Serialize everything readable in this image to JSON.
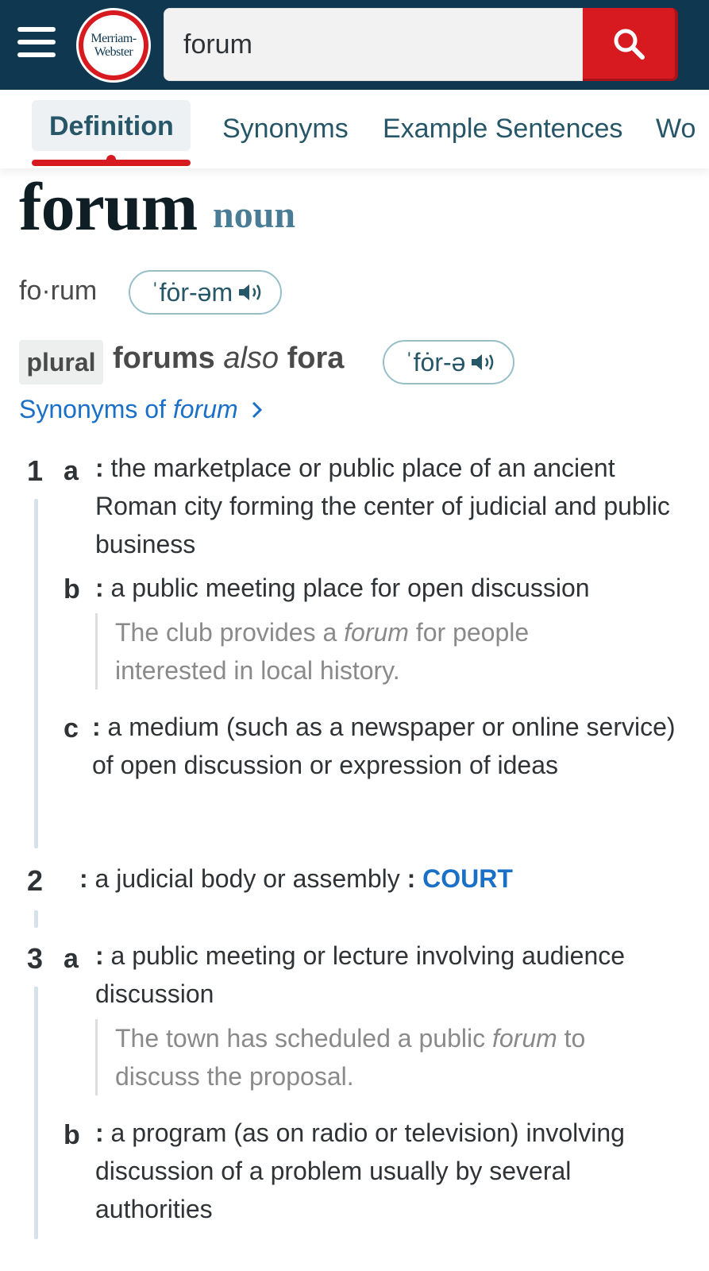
{
  "header": {
    "logo_line1": "Merriam-",
    "logo_line2": "Webster",
    "search_value": "forum"
  },
  "tabs": [
    {
      "label": "Definition",
      "active": true
    },
    {
      "label": "Synonyms"
    },
    {
      "label": "Example Sentences"
    },
    {
      "label": "Wo"
    }
  ],
  "entry": {
    "headword": "forum",
    "part_of_speech": "noun",
    "syllables": "fo·rum",
    "pronunciation": "ˈfȯr-əm",
    "plural_label": "plural",
    "plural_form1": "forums",
    "plural_also": "also",
    "plural_form2": "fora",
    "plural_pronunciation": "ˈfȯr-ə",
    "synonyms_link_prefix": "Synonyms of",
    "synonyms_link_word": "forum"
  },
  "senses": {
    "s1": {
      "num": "1",
      "a_letter": "a",
      "a_text": "the marketplace or public place of an ancient Roman city forming the center of judicial and public business",
      "b_letter": "b",
      "b_text": "a public meeting place for open discussion",
      "b_example_pre": "The club provides a",
      "b_example_word": "forum",
      "b_example_post": "for people interested in local history.",
      "c_letter": "c",
      "c_text": "a medium (such as a newspaper or online service) of open discussion or expression of ideas"
    },
    "s2": {
      "num": "2",
      "text": "a judicial body or assembly",
      "xref": "COURT"
    },
    "s3": {
      "num": "3",
      "a_letter": "a",
      "a_text": "a public meeting or lecture involving audience discussion",
      "a_example_pre": "The town has scheduled a public",
      "a_example_word": "forum",
      "a_example_post": "to discuss the proposal.",
      "b_letter": "b",
      "b_text": "a program (as on radio or television) involving discussion of a problem usually by several authorities"
    }
  },
  "colors": {
    "header_bg": "#0f3850",
    "brand_red": "#d71920",
    "link_blue": "#1a70c7",
    "accent_teal": "#265667"
  }
}
